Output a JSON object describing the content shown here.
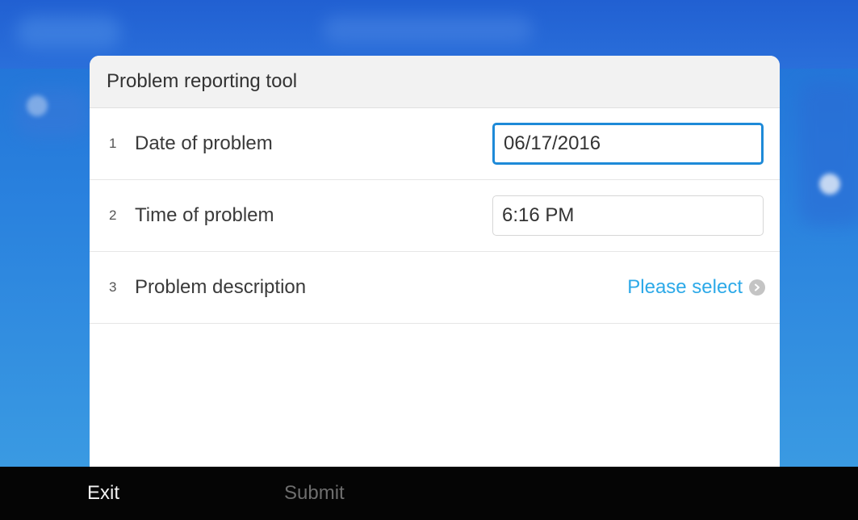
{
  "dialog": {
    "title": "Problem reporting tool",
    "rows": [
      {
        "number": "1",
        "label": "Date of problem",
        "value": "06/17/2016"
      },
      {
        "number": "2",
        "label": "Time of problem",
        "value": "6:16 PM"
      },
      {
        "number": "3",
        "label": "Problem description",
        "select_label": "Please select"
      }
    ]
  },
  "footer": {
    "exit_label": "Exit",
    "submit_label": "Submit"
  },
  "icons": {
    "description_select": "chevron-right-circle-icon"
  },
  "colors": {
    "accent": "#2ca9e8",
    "focus_border": "#1e8ad8",
    "footer_bg": "#050505"
  }
}
